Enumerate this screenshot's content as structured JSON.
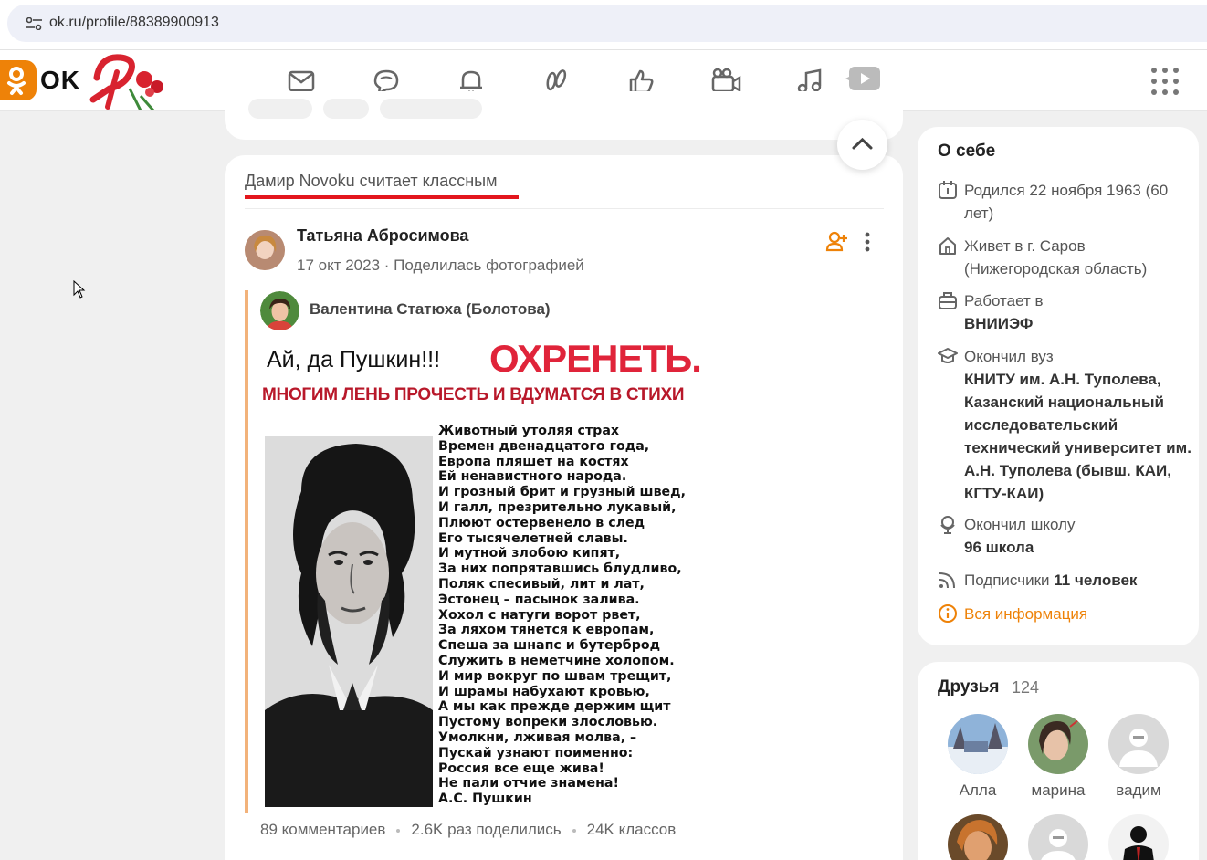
{
  "browser": {
    "url": "ok.ru/profile/88389900913"
  },
  "header": {
    "logo_text": "OK",
    "nav": [
      "mail-icon",
      "discussions-icon",
      "notifications-icon",
      "guests-icon",
      "events-icon",
      "video-icon",
      "music-icon",
      "video-play-icon",
      "apps-grid-icon"
    ]
  },
  "post": {
    "liked_by": "Дамир Novoku считает классным",
    "author": "Татьяна Абросимова",
    "meta": "17 окт 2023 · Поделилась фотографией",
    "reshared_author": "Валентина Статюха (Болотова)",
    "image": {
      "title": "Ай, да Пушкин!!!",
      "big_text": "ОХРЕНЕТЬ.",
      "subtitle": "МНОГИМ ЛЕНЬ ПРОЧЕСТЬ И ВДУМАТСЯ В СТИХИ",
      "poem": [
        "Животный утоляя страх",
        "Времен двенадцатого года,",
        "Европа пляшет на костях",
        "Ей ненавистного народа.",
        "И грозный брит и грузный швед,",
        "И галл, презрительно лукавый,",
        "Плюют остервенело в след",
        "Его тысячелетней славы.",
        "И мутной злобою кипят,",
        "За них попрятавшись блудливо,",
        "Поляк спесивый, лит и лат,",
        "Эстонец – пасынок залива.",
        "Хохол с натуги ворот рвет,",
        "За ляхом тянется к европам,",
        "Спеша за шнапс и бутерброд",
        "Служить в неметчине холопом.",
        "И мир вокруг по швам трещит,",
        "И шрамы набухают кровью,",
        "А мы как прежде держим щит",
        "Пустому вопреки злословью.",
        "Умолкни, лживая молва, –",
        "Пускай узнают поименно:",
        "Россия все еще жива!",
        "Не пали отчие знамена!",
        "А.С. Пушкин"
      ]
    },
    "stats": {
      "comments": "89 комментариев",
      "shares": "2.6K раз поделились",
      "klass": "24K классов"
    }
  },
  "about": {
    "title": "О себе",
    "born": "Родился 22 ноября 1963 (60 лет)",
    "lives": "Живет в г. Саров (Нижегородская область)",
    "work_label": "Работает в",
    "work_value": "ВНИИЭФ",
    "uni_label": "Окончил вуз",
    "uni_value": "КНИТУ им. А.Н. Туполева, Казанский национальный исследовательский технический университет им. А.Н. Туполева (бывш. КАИ, КГТУ-КАИ)",
    "school_label": "Окончил школу",
    "school_value": "96 школа",
    "subs_label": "Подписчики",
    "subs_value": "11 человек",
    "all_info": "Вся информация"
  },
  "friends": {
    "title": "Друзья",
    "count": "124",
    "list": [
      {
        "name": "Алла"
      },
      {
        "name": "марина"
      },
      {
        "name": "вадим"
      }
    ]
  },
  "colors": {
    "brand": "#ee8208",
    "accent_red": "#e3161d",
    "reshare_bar": "#f2b27a"
  }
}
